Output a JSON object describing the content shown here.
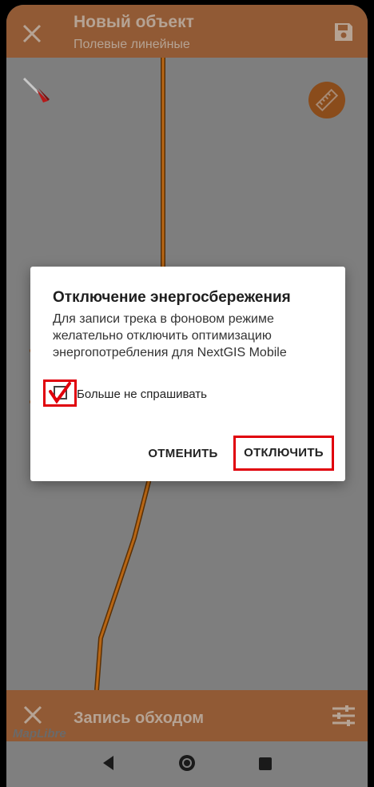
{
  "appbar": {
    "title": "Новый объект",
    "subtitle": "Полевые линейные"
  },
  "bottom_panel": {
    "label": "Запись обходом",
    "attribution": "MapLibre"
  },
  "dialog": {
    "title": "Отключение энергосбережения",
    "message": "Для записи трека в фоновом режиме желательно отключить оптимизацию энергопотребления для NextGIS Mobile",
    "checkbox_label": "Больше не спрашивать",
    "checkbox_checked": true,
    "cancel_label": "ОТМЕНИТЬ",
    "confirm_label": "ОТКЛЮЧИТЬ"
  },
  "colors": {
    "accent": "#915a35",
    "track": "#b86614",
    "highlight": "#e0000b"
  },
  "icons": [
    "close-icon",
    "save-icon",
    "compass-icon",
    "ruler-icon",
    "sliders-icon",
    "back-icon",
    "home-icon",
    "recents-icon"
  ]
}
